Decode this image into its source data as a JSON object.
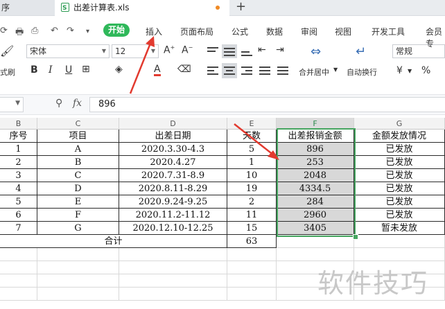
{
  "tabs": {
    "prev_fragment": "序",
    "active_file": "出差计算表.xls",
    "add": "+"
  },
  "menu": {
    "start": "开始",
    "items": [
      "插入",
      "页面布局",
      "公式",
      "数据",
      "审阅",
      "视图",
      "开发工具",
      "会员专"
    ]
  },
  "ribbon": {
    "format_painter_fragment": "式刷",
    "font_name": "宋体",
    "font_size": "12",
    "bold": "B",
    "italic": "I",
    "underline": "U",
    "font_color_letter": "A",
    "merge_label": "合并居中",
    "wrap_label": "自动换行",
    "number_format": "常规",
    "currency": "¥",
    "percent": "%"
  },
  "formula": {
    "fx": "fx",
    "value": "896"
  },
  "columns": [
    "B",
    "C",
    "D",
    "E",
    "F",
    "G"
  ],
  "headers": [
    "序号",
    "项目",
    "出差日期",
    "天数",
    "出差报销金额",
    "金额发放情况"
  ],
  "rows": [
    [
      "1",
      "A",
      "2020.3.30-4.3",
      "5",
      "896",
      "已发放"
    ],
    [
      "2",
      "B",
      "2020.4.27",
      "1",
      "253",
      "已发放"
    ],
    [
      "3",
      "C",
      "2020.7.31-8.9",
      "10",
      "2048",
      "已发放"
    ],
    [
      "4",
      "D",
      "2020.8.11-8.29",
      "19",
      "4334.5",
      "已发放"
    ],
    [
      "5",
      "E",
      "2020.9.24-9.25",
      "2",
      "284",
      "已发放"
    ],
    [
      "6",
      "F",
      "2020.11.2-11.12",
      "11",
      "2960",
      "已发放"
    ],
    [
      "7",
      "G",
      "2020.12.10-12.25",
      "15",
      "3405",
      "暂未发放"
    ]
  ],
  "total": {
    "label": "合计",
    "days": "63"
  },
  "watermark": "软件技巧",
  "colors": {
    "accent_green": "#2fb85a",
    "selection_border": "#46a560",
    "arrow_red": "#e23a2f"
  }
}
